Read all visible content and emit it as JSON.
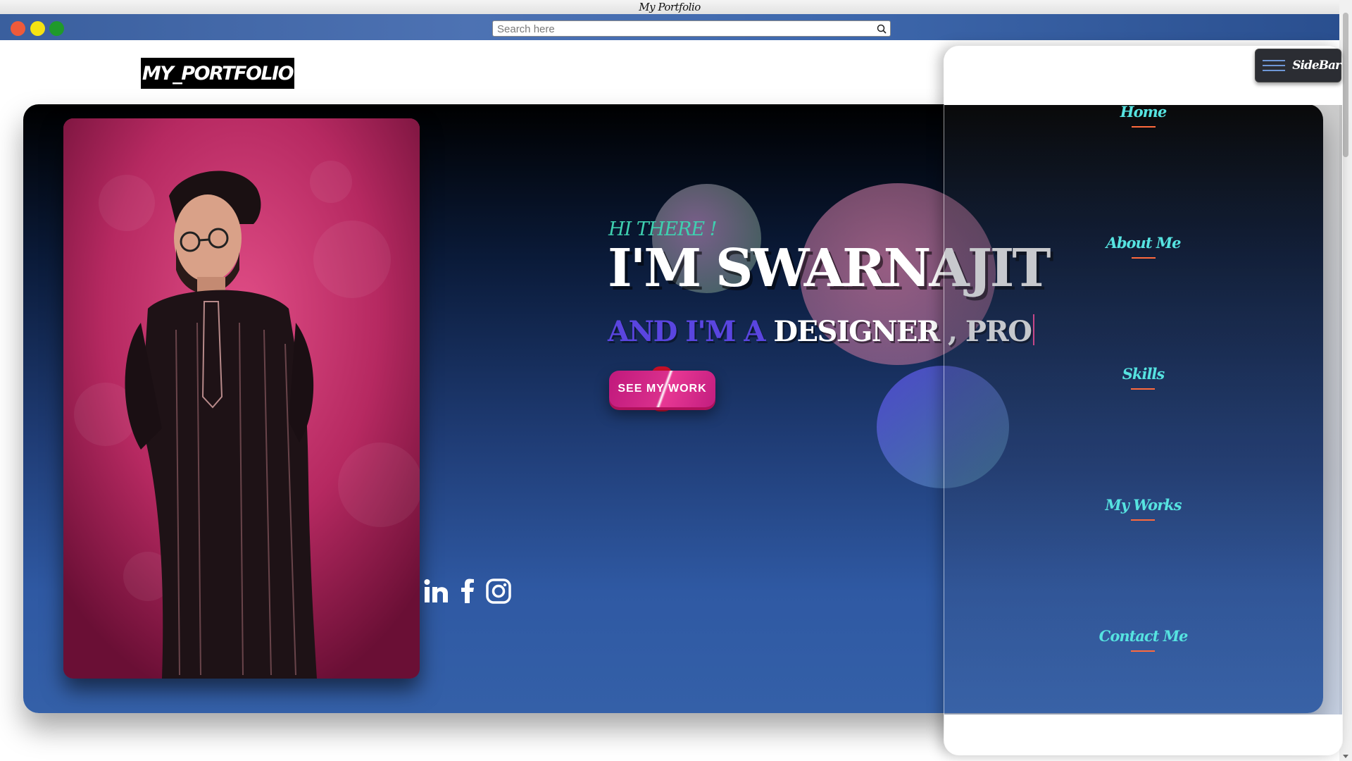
{
  "window": {
    "title": "My Portfolio",
    "controls": [
      "close",
      "minimize",
      "maximize"
    ]
  },
  "search": {
    "placeholder": "Search here",
    "value": "",
    "icon": "search-icon"
  },
  "logo": {
    "text": "MY_PORTFOLIO"
  },
  "hero": {
    "greeting": "HI THERE !",
    "name": "I'M SWARNAJIT",
    "role_prefix": "AND I'M A",
    "role_typed": "DESIGNER , PRO",
    "cta_label": "SEE MY WORK",
    "socials": [
      "linkedin-icon",
      "facebook-icon",
      "instagram-icon"
    ]
  },
  "sidebar": {
    "toggle_label": "SideBar",
    "items": [
      {
        "label": "Home"
      },
      {
        "label": "About Me"
      },
      {
        "label": "Skills"
      },
      {
        "label": "My Works"
      },
      {
        "label": "Contact Me"
      }
    ]
  },
  "colors": {
    "accent_teal": "#56e3e0",
    "accent_purple": "#5a45e0",
    "cta_pink": "#c0197c",
    "underline_orange": "#ff6a3d",
    "hero_gradient_top": "#000000",
    "hero_gradient_bottom": "#3460a8"
  }
}
